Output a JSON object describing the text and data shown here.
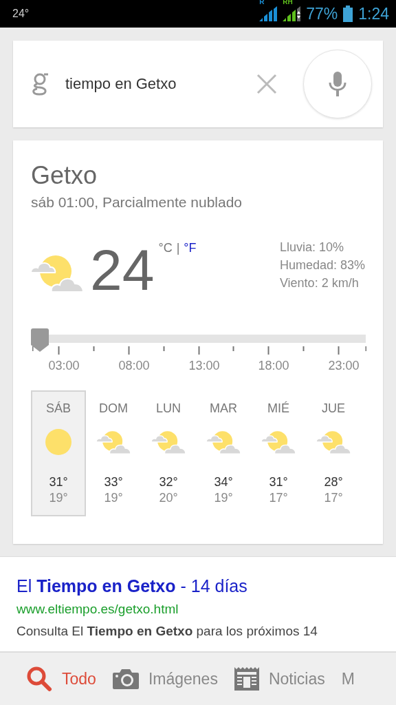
{
  "status_bar": {
    "temperature": "24°",
    "signal_1_label": "R",
    "signal_2_label": "RH",
    "battery": "77%",
    "time": "1:24"
  },
  "search": {
    "value": "tiempo en Getxo"
  },
  "weather": {
    "location": "Getxo",
    "conditions": "sáb 01:00, Parcialmente nublado",
    "current": {
      "kind": "partly"
    },
    "temperature": "24",
    "units": [
      {
        "label": "°C",
        "selected": true
      },
      {
        "label": "°F",
        "selected": false
      }
    ],
    "unit_separator": "|",
    "details": [
      "Lluvia: 10%",
      "Humedad: 83%",
      "Viento: 2 km/h"
    ],
    "timeline": {
      "level": 0,
      "labels": [
        "03:00",
        "08:00",
        "13:00",
        "18:00",
        "23:00"
      ]
    },
    "forecast": [
      {
        "day": "SÁB",
        "kind": "sunny",
        "high": "31°",
        "low": "19°",
        "selected": true
      },
      {
        "day": "DOM",
        "kind": "partly",
        "high": "33°",
        "low": "19°",
        "selected": false
      },
      {
        "day": "LUN",
        "kind": "partly",
        "high": "32°",
        "low": "20°",
        "selected": false
      },
      {
        "day": "MAR",
        "kind": "partly",
        "high": "34°",
        "low": "19°",
        "selected": false
      },
      {
        "day": "MIÉ",
        "kind": "partly",
        "high": "31°",
        "low": "17°",
        "selected": false
      },
      {
        "day": "JUE",
        "kind": "partly",
        "high": "28°",
        "low": "17°",
        "selected": false
      }
    ]
  },
  "result": {
    "title": "El **Tiempo en Getxo** - 14 días",
    "url": "www.eltiempo.es/getxo.html",
    "snippet": "Consulta El **Tiempo en Getxo** para los próximos 14"
  },
  "tabs": [
    {
      "label": "Todo",
      "kind": "search",
      "selected": true
    },
    {
      "label": "Imágenes",
      "kind": "images",
      "selected": false
    },
    {
      "label": "Noticias",
      "kind": "news",
      "selected": false
    },
    {
      "label": "M",
      "kind": "more",
      "selected": false
    }
  ]
}
